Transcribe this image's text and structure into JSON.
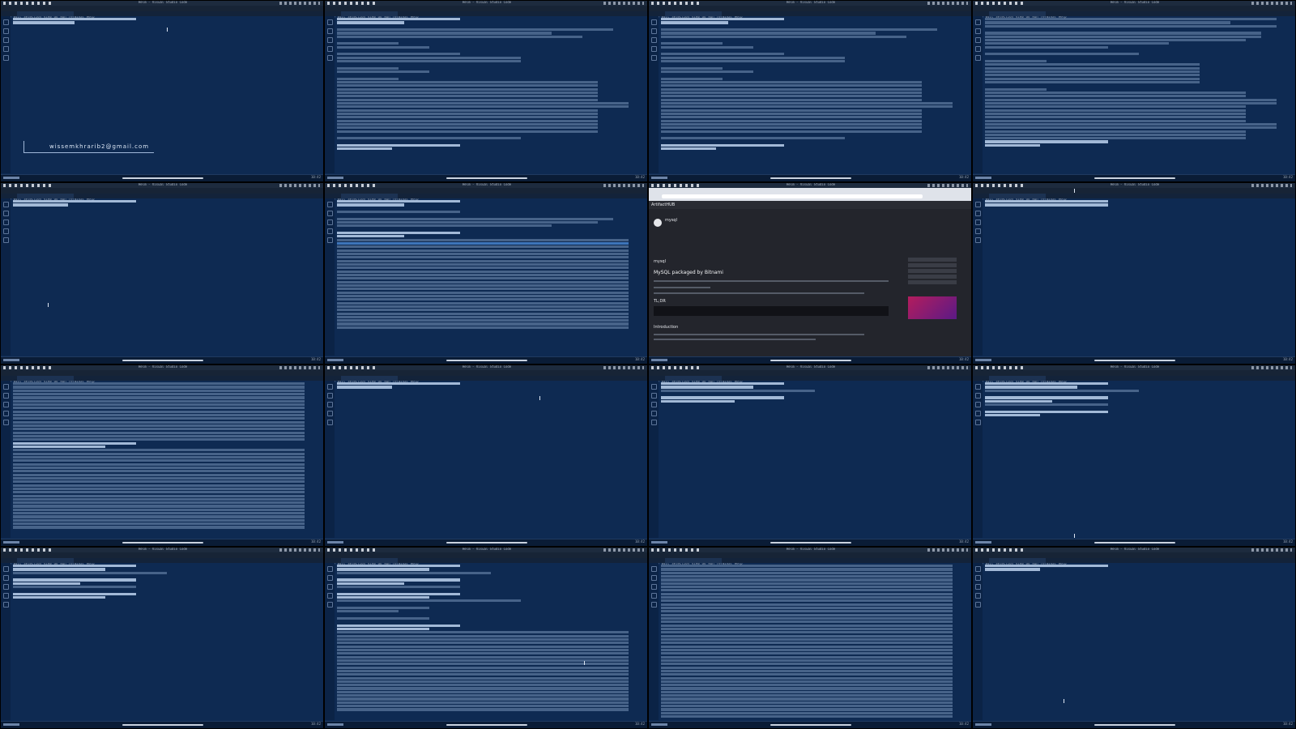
{
  "window": {
    "title": "Helm - Visual Studio Code",
    "menu": [
      "File",
      "Edit",
      "Selection",
      "View",
      "Go",
      "Run",
      "Terminal",
      "Help"
    ],
    "clock": "10:42"
  },
  "overlay": {
    "email": "wissemkhrarib2@gmail.com"
  },
  "browser": {
    "brand": "ArtifactHUB",
    "package": "mysql",
    "section_title": "mysql",
    "heading": "MySQL packaged by Bitnami",
    "tldr": "TL;DR",
    "intro": "Introduction"
  },
  "colors": {
    "terminal_bg": "#0e2a52",
    "accent": "#5fa9ff"
  },
  "tiles": [
    {
      "kind": "terminal",
      "lines": [
        [
          "p",
          40
        ],
        [
          "p",
          20
        ]
      ],
      "email": true,
      "cursor": [
        205,
        33
      ]
    },
    {
      "kind": "terminal",
      "lines": [
        [
          "p",
          40
        ],
        [
          "p",
          22
        ],
        [
          "t",
          0
        ],
        [
          "t",
          90
        ],
        [
          "t",
          70
        ],
        [
          "t",
          80
        ],
        [
          "t",
          0
        ],
        [
          "t",
          20
        ],
        [
          "t",
          30
        ],
        [
          "t",
          0
        ],
        [
          "t",
          40
        ],
        [
          "t",
          60
        ],
        [
          "t",
          60
        ],
        [
          "t",
          0
        ],
        [
          "t",
          20
        ],
        [
          "t",
          30
        ],
        [
          "t",
          0
        ],
        [
          "t",
          20
        ],
        [
          "t",
          85
        ],
        [
          "t",
          85
        ],
        [
          "t",
          85
        ],
        [
          "t",
          85
        ],
        [
          "t",
          85
        ],
        [
          "t",
          85
        ],
        [
          "t",
          95
        ],
        [
          "t",
          95
        ],
        [
          "t",
          85
        ],
        [
          "t",
          85
        ],
        [
          "t",
          85
        ],
        [
          "t",
          85
        ],
        [
          "t",
          85
        ],
        [
          "t",
          85
        ],
        [
          "t",
          85
        ],
        [
          "t",
          0
        ],
        [
          "t",
          60
        ],
        [
          "t",
          0
        ],
        [
          "p",
          40
        ],
        [
          "p",
          18
        ]
      ]
    },
    {
      "kind": "terminal",
      "lines": [
        [
          "p",
          40
        ],
        [
          "p",
          22
        ],
        [
          "t",
          0
        ],
        [
          "t",
          90
        ],
        [
          "t",
          70
        ],
        [
          "t",
          80
        ],
        [
          "t",
          0
        ],
        [
          "t",
          20
        ],
        [
          "t",
          30
        ],
        [
          "t",
          0
        ],
        [
          "t",
          40
        ],
        [
          "t",
          60
        ],
        [
          "t",
          60
        ],
        [
          "t",
          0
        ],
        [
          "t",
          20
        ],
        [
          "t",
          30
        ],
        [
          "t",
          0
        ],
        [
          "t",
          20
        ],
        [
          "t",
          85
        ],
        [
          "t",
          85
        ],
        [
          "t",
          85
        ],
        [
          "t",
          85
        ],
        [
          "t",
          85
        ],
        [
          "t",
          85
        ],
        [
          "t",
          95
        ],
        [
          "t",
          95
        ],
        [
          "t",
          85
        ],
        [
          "t",
          85
        ],
        [
          "t",
          85
        ],
        [
          "t",
          85
        ],
        [
          "t",
          85
        ],
        [
          "t",
          85
        ],
        [
          "t",
          85
        ],
        [
          "t",
          0
        ],
        [
          "t",
          60
        ],
        [
          "t",
          0
        ],
        [
          "p",
          40
        ],
        [
          "p",
          18
        ]
      ]
    },
    {
      "kind": "terminal",
      "lines": [
        [
          "t",
          95
        ],
        [
          "t",
          80
        ],
        [
          "t",
          95
        ],
        [
          "t",
          0
        ],
        [
          "t",
          90
        ],
        [
          "t",
          90
        ],
        [
          "t",
          85
        ],
        [
          "t",
          60
        ],
        [
          "t",
          40
        ],
        [
          "t",
          0
        ],
        [
          "t",
          50
        ],
        [
          "t",
          0
        ],
        [
          "t",
          20
        ],
        [
          "t",
          70
        ],
        [
          "t",
          70
        ],
        [
          "t",
          70
        ],
        [
          "t",
          70
        ],
        [
          "t",
          70
        ],
        [
          "t",
          70
        ],
        [
          "t",
          0
        ],
        [
          "t",
          20
        ],
        [
          "t",
          85
        ],
        [
          "t",
          85
        ],
        [
          "t",
          95
        ],
        [
          "t",
          95
        ],
        [
          "t",
          85
        ],
        [
          "t",
          85
        ],
        [
          "t",
          85
        ],
        [
          "t",
          85
        ],
        [
          "t",
          85
        ],
        [
          "t",
          95
        ],
        [
          "t",
          95
        ],
        [
          "t",
          85
        ],
        [
          "t",
          85
        ],
        [
          "t",
          85
        ],
        [
          "p",
          40
        ],
        [
          "p",
          18
        ]
      ]
    },
    {
      "kind": "terminal",
      "lines": [
        [
          "p",
          40
        ],
        [
          "p",
          18
        ]
      ],
      "cursor": [
        58,
        148
      ]
    },
    {
      "kind": "terminal",
      "lines": [
        [
          "p",
          40
        ],
        [
          "p",
          22
        ],
        [
          "t",
          0
        ],
        [
          "t",
          40
        ],
        [
          "t",
          0
        ],
        [
          "t",
          90
        ],
        [
          "t",
          85
        ],
        [
          "t",
          70
        ],
        [
          "t",
          0
        ],
        [
          "p",
          40
        ],
        [
          "p",
          22
        ],
        [
          "t",
          95
        ],
        [
          "h",
          95
        ],
        [
          "t",
          95
        ],
        [
          "t",
          95
        ],
        [
          "t",
          95
        ],
        [
          "t",
          95
        ],
        [
          "t",
          95
        ],
        [
          "t",
          95
        ],
        [
          "t",
          95
        ],
        [
          "t",
          95
        ],
        [
          "t",
          95
        ],
        [
          "t",
          95
        ],
        [
          "t",
          95
        ],
        [
          "t",
          95
        ],
        [
          "t",
          95
        ],
        [
          "t",
          95
        ],
        [
          "t",
          95
        ],
        [
          "t",
          95
        ],
        [
          "t",
          95
        ],
        [
          "t",
          95
        ],
        [
          "t",
          95
        ],
        [
          "t",
          95
        ],
        [
          "t",
          95
        ],
        [
          "t",
          95
        ],
        [
          "t",
          95
        ],
        [
          "t",
          95
        ]
      ]
    },
    {
      "kind": "browser"
    },
    {
      "kind": "terminal",
      "lines": [
        [
          "p",
          40
        ],
        [
          "p",
          40
        ]
      ],
      "cursor": [
        125,
        7
      ]
    },
    {
      "kind": "terminal",
      "lines": [
        [
          "t",
          95
        ],
        [
          "t",
          95
        ],
        [
          "t",
          95
        ],
        [
          "t",
          95
        ],
        [
          "t",
          95
        ],
        [
          "t",
          95
        ],
        [
          "t",
          95
        ],
        [
          "t",
          95
        ],
        [
          "t",
          95
        ],
        [
          "t",
          95
        ],
        [
          "t",
          95
        ],
        [
          "t",
          95
        ],
        [
          "t",
          95
        ],
        [
          "t",
          95
        ],
        [
          "t",
          95
        ],
        [
          "t",
          95
        ],
        [
          "t",
          95
        ],
        [
          "p",
          40
        ],
        [
          "p",
          30
        ],
        [
          "t",
          95
        ],
        [
          "t",
          95
        ],
        [
          "t",
          95
        ],
        [
          "t",
          95
        ],
        [
          "t",
          95
        ],
        [
          "t",
          95
        ],
        [
          "t",
          95
        ],
        [
          "t",
          95
        ],
        [
          "t",
          95
        ],
        [
          "t",
          95
        ],
        [
          "t",
          95
        ],
        [
          "t",
          95
        ],
        [
          "t",
          95
        ],
        [
          "t",
          95
        ],
        [
          "t",
          95
        ],
        [
          "t",
          95
        ],
        [
          "t",
          95
        ],
        [
          "t",
          95
        ],
        [
          "t",
          95
        ],
        [
          "t",
          95
        ],
        [
          "t",
          95
        ],
        [
          "t",
          95
        ],
        [
          "t",
          95
        ]
      ]
    },
    {
      "kind": "terminal",
      "lines": [
        [
          "p",
          40
        ],
        [
          "p",
          18
        ]
      ],
      "cursor": [
        265,
        38
      ]
    },
    {
      "kind": "terminal",
      "lines": [
        [
          "p",
          40
        ],
        [
          "p",
          30
        ],
        [
          "t",
          50
        ],
        [
          "t",
          0
        ],
        [
          "p",
          40
        ],
        [
          "p",
          24
        ]
      ]
    },
    {
      "kind": "terminal",
      "lines": [
        [
          "p",
          40
        ],
        [
          "p",
          30
        ],
        [
          "t",
          50
        ],
        [
          "t",
          0
        ],
        [
          "p",
          40
        ],
        [
          "p",
          22
        ],
        [
          "t",
          40
        ],
        [
          "t",
          0
        ],
        [
          "p",
          40
        ],
        [
          "p",
          18
        ]
      ],
      "cursor": [
        125,
        208
      ]
    },
    {
      "kind": "terminal",
      "lines": [
        [
          "p",
          40
        ],
        [
          "p",
          30
        ],
        [
          "t",
          50
        ],
        [
          "t",
          0
        ],
        [
          "p",
          40
        ],
        [
          "p",
          22
        ],
        [
          "t",
          40
        ],
        [
          "t",
          0
        ],
        [
          "p",
          40
        ],
        [
          "p",
          30
        ]
      ]
    },
    {
      "kind": "terminal",
      "lines": [
        [
          "p",
          40
        ],
        [
          "p",
          30
        ],
        [
          "t",
          50
        ],
        [
          "t",
          0
        ],
        [
          "p",
          40
        ],
        [
          "p",
          22
        ],
        [
          "t",
          40
        ],
        [
          "t",
          0
        ],
        [
          "p",
          40
        ],
        [
          "p",
          30
        ],
        [
          "t",
          60
        ],
        [
          "t",
          0
        ],
        [
          "t",
          30
        ],
        [
          "t",
          20
        ],
        [
          "t",
          0
        ],
        [
          "t",
          30
        ],
        [
          "t",
          0
        ],
        [
          "p",
          40
        ],
        [
          "p",
          30
        ],
        [
          "t",
          95
        ],
        [
          "t",
          95
        ],
        [
          "t",
          95
        ],
        [
          "t",
          95
        ],
        [
          "t",
          95
        ],
        [
          "t",
          95
        ],
        [
          "t",
          95
        ],
        [
          "t",
          95
        ],
        [
          "t",
          95
        ],
        [
          "t",
          95
        ],
        [
          "t",
          95
        ],
        [
          "t",
          95
        ],
        [
          "t",
          95
        ],
        [
          "t",
          95
        ],
        [
          "t",
          95
        ],
        [
          "t",
          95
        ],
        [
          "t",
          95
        ],
        [
          "t",
          95
        ],
        [
          "t",
          95
        ],
        [
          "t",
          95
        ],
        [
          "t",
          95
        ],
        [
          "t",
          95
        ],
        [
          "t",
          95
        ]
      ],
      "cursor": [
        320,
        140
      ]
    },
    {
      "kind": "terminal",
      "lines": [
        [
          "t",
          95
        ],
        [
          "t",
          95
        ],
        [
          "t",
          95
        ],
        [
          "t",
          95
        ],
        [
          "t",
          95
        ],
        [
          "t",
          95
        ],
        [
          "t",
          95
        ],
        [
          "t",
          95
        ],
        [
          "t",
          95
        ],
        [
          "t",
          95
        ],
        [
          "t",
          95
        ],
        [
          "t",
          95
        ],
        [
          "t",
          95
        ],
        [
          "t",
          95
        ],
        [
          "t",
          95
        ],
        [
          "t",
          95
        ],
        [
          "t",
          95
        ],
        [
          "t",
          95
        ],
        [
          "t",
          95
        ],
        [
          "t",
          95
        ],
        [
          "t",
          95
        ],
        [
          "t",
          95
        ],
        [
          "t",
          95
        ],
        [
          "t",
          95
        ],
        [
          "t",
          95
        ],
        [
          "t",
          95
        ],
        [
          "t",
          95
        ],
        [
          "t",
          95
        ],
        [
          "t",
          95
        ],
        [
          "t",
          95
        ],
        [
          "t",
          95
        ],
        [
          "t",
          95
        ],
        [
          "t",
          95
        ],
        [
          "t",
          95
        ],
        [
          "t",
          95
        ],
        [
          "t",
          95
        ],
        [
          "t",
          95
        ],
        [
          "t",
          95
        ],
        [
          "t",
          95
        ],
        [
          "t",
          95
        ],
        [
          "t",
          95
        ],
        [
          "t",
          95
        ],
        [
          "t",
          95
        ],
        [
          "t",
          95
        ]
      ]
    },
    {
      "kind": "terminal",
      "lines": [
        [
          "p",
          40
        ],
        [
          "p",
          18
        ]
      ],
      "cursor": [
        112,
        187
      ]
    }
  ]
}
